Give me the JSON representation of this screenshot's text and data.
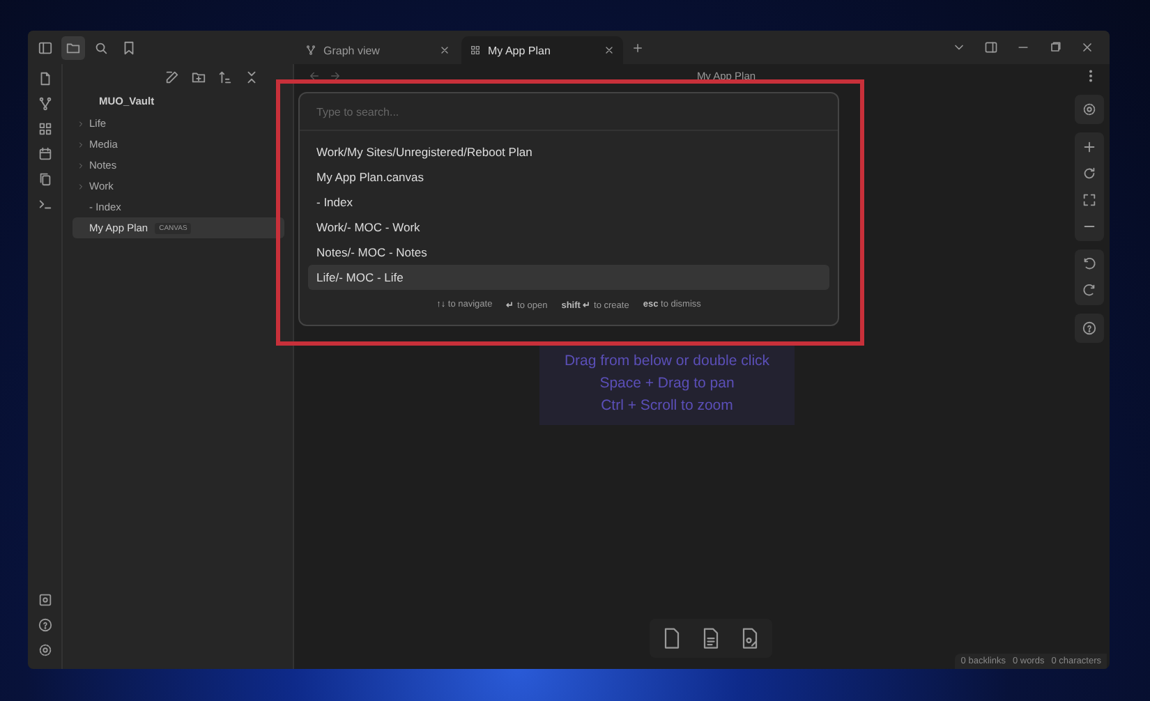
{
  "tabs": [
    {
      "label": "Graph view",
      "kind": "graph",
      "selected": false
    },
    {
      "label": "My App Plan",
      "kind": "canvas",
      "selected": true
    }
  ],
  "sidebar": {
    "vault": "MUO_Vault",
    "items": [
      {
        "label": "Life",
        "kind": "folder",
        "expanded": false,
        "selected": false
      },
      {
        "label": "Media",
        "kind": "folder",
        "expanded": false,
        "selected": false
      },
      {
        "label": "Notes",
        "kind": "folder",
        "expanded": false,
        "selected": false
      },
      {
        "label": "Work",
        "kind": "folder",
        "expanded": false,
        "selected": false
      },
      {
        "label": "- Index",
        "kind": "file",
        "selected": false
      },
      {
        "label": "My App Plan",
        "kind": "file",
        "badge": "CANVAS",
        "selected": true
      }
    ]
  },
  "view": {
    "title": "My App Plan",
    "hint": [
      "Drag from below or double click",
      "Space + Drag to pan",
      "Ctrl + Scroll to zoom"
    ]
  },
  "switcher": {
    "placeholder": "Type to search...",
    "results": [
      {
        "label": "Work/My Sites/Unregistered/Reboot Plan",
        "selected": false
      },
      {
        "label": "My App Plan.canvas",
        "selected": false
      },
      {
        "label": "- Index",
        "selected": false
      },
      {
        "label": "Work/- MOC - Work",
        "selected": false
      },
      {
        "label": "Notes/- MOC - Notes",
        "selected": false
      },
      {
        "label": "Life/- MOC - Life",
        "selected": true
      }
    ],
    "instructions": [
      {
        "key": "↑↓",
        "text": "to navigate"
      },
      {
        "key": "↵",
        "text": "to open"
      },
      {
        "key": "shift ↵",
        "text": "to create"
      },
      {
        "key": "esc",
        "text": "to dismiss"
      }
    ]
  },
  "status_bar": [
    "0 backlinks",
    "0 words",
    "0 characters"
  ]
}
